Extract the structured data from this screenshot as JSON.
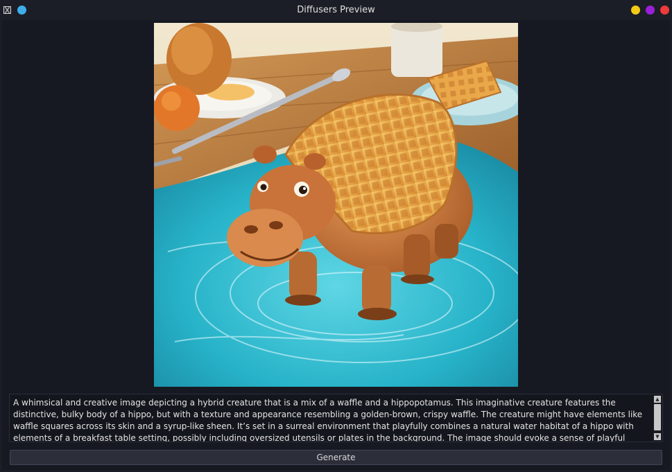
{
  "window": {
    "title": "Diffusers Preview",
    "colors": {
      "pin": "#3daee9",
      "minimize": "#f6c915",
      "maximize": "#9a20d8",
      "close": "#ef3b3b"
    }
  },
  "image": {
    "subject": "waffle-hippo",
    "scene": {
      "water": "#2bb8c9",
      "table": "#b9793d",
      "waffle": "#e7a24a",
      "hippo": "#c9763a"
    }
  },
  "prompt": {
    "text": "A whimsical and creative image depicting a hybrid creature that is a mix of a waffle and a hippopotamus. This imaginative creature features the distinctive, bulky body of a hippo, but with a texture and appearance resembling a golden-brown, crispy waffle. The creature might have elements like waffle squares across its skin and a syrup-like sheen. It’s set in a surreal environment that playfully combines a natural water habitat of a hippo with elements of a breakfast table setting, possibly including oversized utensils or plates in the background. The image should evoke a sense of playful absurdity and culinary fantasy."
  },
  "scrollbar": {
    "up_arrow": "▲",
    "down_arrow": "▼"
  },
  "actions": {
    "generate_label": "Generate"
  }
}
